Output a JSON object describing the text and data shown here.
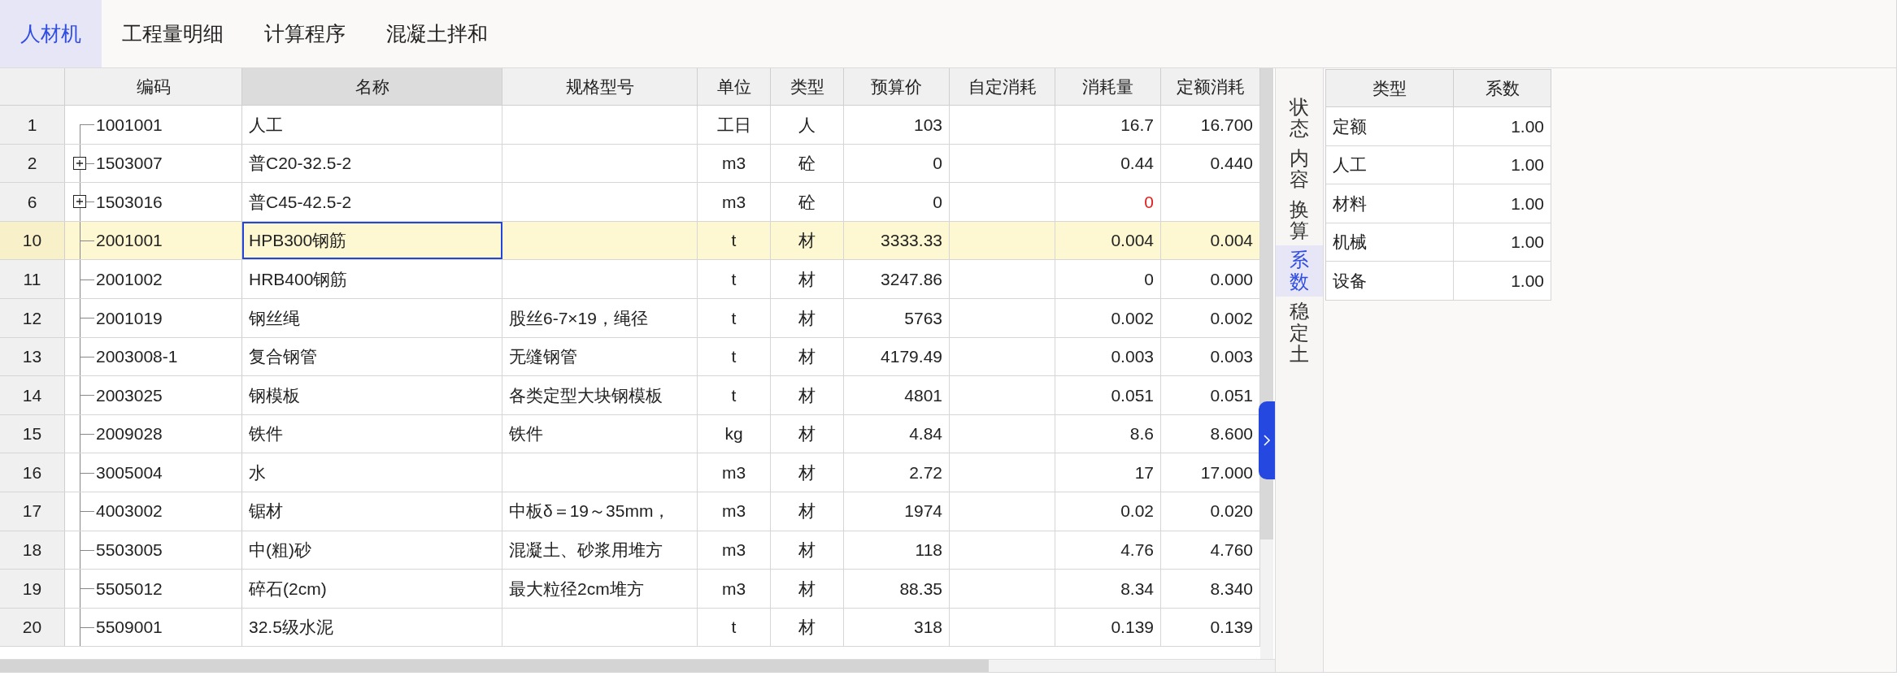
{
  "tabs": [
    {
      "label": "人材机",
      "selected": true
    },
    {
      "label": "工程量明细",
      "selected": false
    },
    {
      "label": "计算程序",
      "selected": false
    },
    {
      "label": "混凝土拌和",
      "selected": false
    }
  ],
  "table": {
    "columns": [
      {
        "label": "编码",
        "selected": false
      },
      {
        "label": "名称",
        "selected": true
      },
      {
        "label": "规格型号",
        "selected": false
      },
      {
        "label": "单位",
        "selected": false
      },
      {
        "label": "类型",
        "selected": false
      },
      {
        "label": "预算价",
        "selected": false
      },
      {
        "label": "自定消耗",
        "selected": false
      },
      {
        "label": "消耗量",
        "selected": false
      },
      {
        "label": "定额消耗",
        "selected": false
      }
    ],
    "rows": [
      {
        "index": "1",
        "kind": "leaf",
        "selected": false,
        "alert": false,
        "cells": [
          "1001001",
          "人工",
          "",
          "工日",
          "人",
          "103",
          "",
          "16.7",
          "16.700"
        ]
      },
      {
        "index": "2",
        "kind": "group",
        "expanded": false,
        "selected": false,
        "alert": false,
        "cells": [
          "1503007",
          "普C20-32.5-2",
          "",
          "m3",
          "砼",
          "0",
          "",
          "0.44",
          "0.440"
        ]
      },
      {
        "index": "6",
        "kind": "group",
        "expanded": false,
        "selected": false,
        "alert": true,
        "cells": [
          "1503016",
          "普C45-42.5-2",
          "",
          "m3",
          "砼",
          "0",
          "",
          "0",
          ""
        ]
      },
      {
        "index": "10",
        "kind": "leaf",
        "selected": true,
        "alert": false,
        "cells": [
          "2001001",
          "HPB300钢筋",
          "",
          "t",
          "材",
          "3333.33",
          "",
          "0.004",
          "0.004"
        ]
      },
      {
        "index": "11",
        "kind": "leaf",
        "selected": false,
        "alert": false,
        "cells": [
          "2001002",
          "HRB400钢筋",
          "",
          "t",
          "材",
          "3247.86",
          "",
          "0",
          "0.000"
        ]
      },
      {
        "index": "12",
        "kind": "leaf",
        "selected": false,
        "alert": false,
        "cells": [
          "2001019",
          "钢丝绳",
          "股丝6-7×19，绳径",
          "t",
          "材",
          "5763",
          "",
          "0.002",
          "0.002"
        ]
      },
      {
        "index": "13",
        "kind": "leaf",
        "selected": false,
        "alert": false,
        "cells": [
          "2003008-1",
          "复合钢管",
          "无缝钢管",
          "t",
          "材",
          "4179.49",
          "",
          "0.003",
          "0.003"
        ]
      },
      {
        "index": "14",
        "kind": "leaf",
        "selected": false,
        "alert": false,
        "cells": [
          "2003025",
          "钢模板",
          "各类定型大块钢模板",
          "t",
          "材",
          "4801",
          "",
          "0.051",
          "0.051"
        ]
      },
      {
        "index": "15",
        "kind": "leaf",
        "selected": false,
        "alert": false,
        "cells": [
          "2009028",
          "铁件",
          "铁件",
          "kg",
          "材",
          "4.84",
          "",
          "8.6",
          "8.600"
        ]
      },
      {
        "index": "16",
        "kind": "leaf",
        "selected": false,
        "alert": false,
        "cells": [
          "3005004",
          "水",
          "",
          "m3",
          "材",
          "2.72",
          "",
          "17",
          "17.000"
        ]
      },
      {
        "index": "17",
        "kind": "leaf",
        "selected": false,
        "alert": false,
        "cells": [
          "4003002",
          "锯材",
          "中板δ＝19～35mm，",
          "m3",
          "材",
          "1974",
          "",
          "0.02",
          "0.020"
        ]
      },
      {
        "index": "18",
        "kind": "leaf",
        "selected": false,
        "alert": false,
        "cells": [
          "5503005",
          "中(粗)砂",
          "混凝土、砂浆用堆方",
          "m3",
          "材",
          "118",
          "",
          "4.76",
          "4.760"
        ]
      },
      {
        "index": "19",
        "kind": "leaf",
        "selected": false,
        "alert": false,
        "cells": [
          "5505012",
          "碎石(2cm)",
          "最大粒径2cm堆方",
          "m3",
          "材",
          "88.35",
          "",
          "8.34",
          "8.340"
        ]
      },
      {
        "index": "20",
        "kind": "leaf",
        "selected": false,
        "alert": false,
        "cells": [
          "5509001",
          "32.5级水泥",
          "",
          "t",
          "材",
          "318",
          "",
          "0.139",
          "0.139"
        ]
      }
    ]
  },
  "side_tabs": [
    {
      "label": "状态",
      "selected": false
    },
    {
      "label": "内容",
      "selected": false
    },
    {
      "label": "换算",
      "selected": false
    },
    {
      "label": "系数",
      "selected": true
    },
    {
      "label": "稳定土",
      "selected": false
    }
  ],
  "coefficients": {
    "columns": [
      "类型",
      "系数"
    ],
    "rows": [
      [
        "定额",
        "1.00"
      ],
      [
        "人工",
        "1.00"
      ],
      [
        "材料",
        "1.00"
      ],
      [
        "机械",
        "1.00"
      ],
      [
        "设备",
        "1.00"
      ]
    ]
  }
}
